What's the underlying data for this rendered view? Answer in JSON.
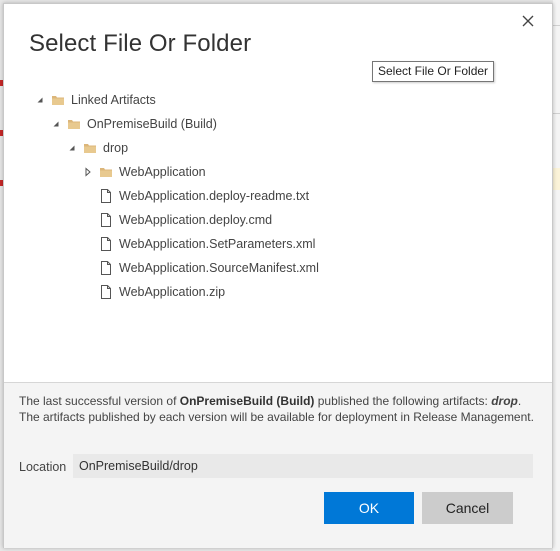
{
  "dialog": {
    "title": "Select File Or Folder",
    "tooltip": "Select File Or Folder"
  },
  "tree": [
    {
      "label": "Linked Artifacts",
      "kind": "folder",
      "state": "expanded",
      "depth": 0
    },
    {
      "label": "OnPremiseBuild (Build)",
      "kind": "folder",
      "state": "expanded",
      "depth": 1
    },
    {
      "label": "drop",
      "kind": "folder",
      "state": "expanded",
      "depth": 2
    },
    {
      "label": "WebApplication",
      "kind": "folder",
      "state": "collapsed",
      "depth": 3
    },
    {
      "label": "WebApplication.deploy-readme.txt",
      "kind": "file",
      "state": "none",
      "depth": 3
    },
    {
      "label": "WebApplication.deploy.cmd",
      "kind": "file",
      "state": "none",
      "depth": 3
    },
    {
      "label": "WebApplication.SetParameters.xml",
      "kind": "file",
      "state": "none",
      "depth": 3
    },
    {
      "label": "WebApplication.SourceManifest.xml",
      "kind": "file",
      "state": "none",
      "depth": 3
    },
    {
      "label": "WebApplication.zip",
      "kind": "file",
      "state": "none",
      "depth": 3
    }
  ],
  "info": {
    "line1_prefix": "The last successful version of ",
    "line1_build": "OnPremiseBuild (Build)",
    "line1_middle": " published the following artifacts: ",
    "line1_artifact": "drop",
    "line1_suffix": ".",
    "line2": "The artifacts published by each version will be available for deployment in Release Management."
  },
  "location": {
    "label": "Location",
    "value": "OnPremiseBuild/drop"
  },
  "buttons": {
    "ok": "OK",
    "cancel": "Cancel"
  },
  "colors": {
    "primary": "#0078d7",
    "folder": "#dcb67a",
    "panel": "#f4f4f4"
  },
  "icons": {
    "close": "close-icon",
    "folder": "folder-icon",
    "file": "file-icon",
    "expanded": "triangle-expanded-icon",
    "collapsed": "triangle-collapsed-icon"
  }
}
